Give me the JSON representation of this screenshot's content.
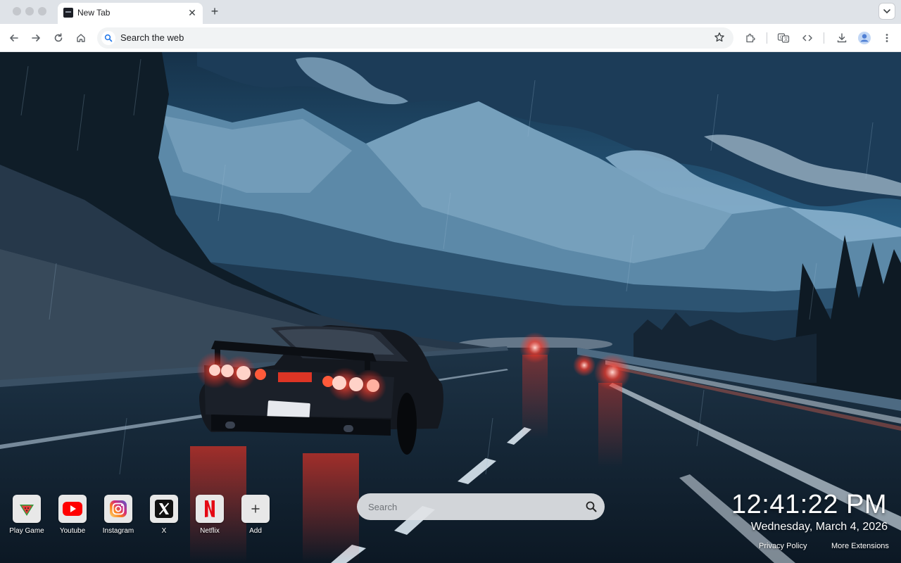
{
  "browser": {
    "tab": {
      "title": "New Tab",
      "favicon": "newtab-app-icon",
      "close_icon": "close-icon"
    },
    "new_tab_icon": "plus-icon",
    "tab_search_icon": "chevron-down-icon",
    "toolbar": {
      "icons": [
        "back-arrow-icon",
        "forward-arrow-icon",
        "reload-icon",
        "home-icon",
        "extensions-puzzle-icon",
        "translate-icon",
        "code-icon",
        "download-icon",
        "profile-avatar-icon",
        "more-vertical-icon"
      ],
      "omnibox": {
        "text": "Search the web",
        "icon": "search-icon",
        "bookmark_icon": "star-icon"
      }
    }
  },
  "page": {
    "shortcuts": [
      {
        "label": "Play Game",
        "icon": "watermelon-icon"
      },
      {
        "label": "Youtube",
        "icon": "youtube-icon"
      },
      {
        "label": "Instagram",
        "icon": "instagram-icon"
      },
      {
        "label": "X",
        "icon": "x-logo-icon"
      },
      {
        "label": "Netflix",
        "icon": "netflix-icon"
      },
      {
        "label": "Add",
        "icon": "plus-icon"
      }
    ],
    "search": {
      "placeholder": "Search",
      "icon": "search-icon"
    },
    "clock": {
      "time": "12:41:22 PM",
      "date": "Wednesday, March 4, 2026"
    },
    "footer": {
      "privacy": "Privacy Policy",
      "more": "More Extensions"
    }
  },
  "colors": {
    "youtube_red": "#ff0000",
    "netflix_red": "#e50914",
    "sky_blue": "#2e6f9e",
    "tail_light": "#ff2a1f"
  }
}
